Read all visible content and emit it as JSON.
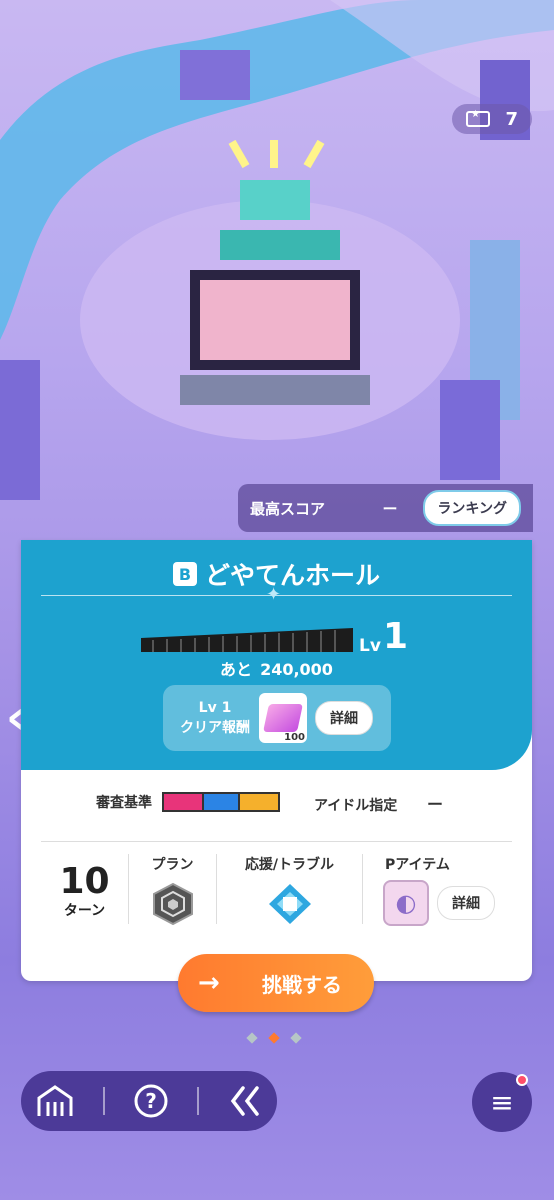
{
  "map": {
    "ticket_count": "7",
    "best_score_label": "最高スコア",
    "best_score_value": "ー",
    "ranking_button": "ランキング"
  },
  "stage": {
    "rank": "B",
    "name": "どやてんホール",
    "level_label": "Lv",
    "level": "1",
    "remaining_label": "あと",
    "remaining_value": "240,000",
    "level_progress": 0,
    "reward_line1": "Lv 1",
    "reward_line2": "クリア報酬",
    "reward_qty": "100",
    "reward_detail_button": "詳細"
  },
  "criteria": {
    "label": "審査基準",
    "colors": [
      "#e8347a",
      "#2b84e5",
      "#f5b02c"
    ],
    "idol_label": "アイドル指定",
    "idol_value": "ー"
  },
  "info": {
    "turns_value": "10",
    "turns_unit": "ターン",
    "plan_label": "プラン",
    "support_label": "応援/トラブル",
    "pitem_label": "Pアイテム",
    "pitem_detail_button": "詳細"
  },
  "challenge_button": "挑戦する",
  "pager": {
    "count": 3,
    "active": 1
  },
  "nav": {
    "home": "home-icon",
    "help": "?",
    "back": "«",
    "menu": "≡"
  }
}
